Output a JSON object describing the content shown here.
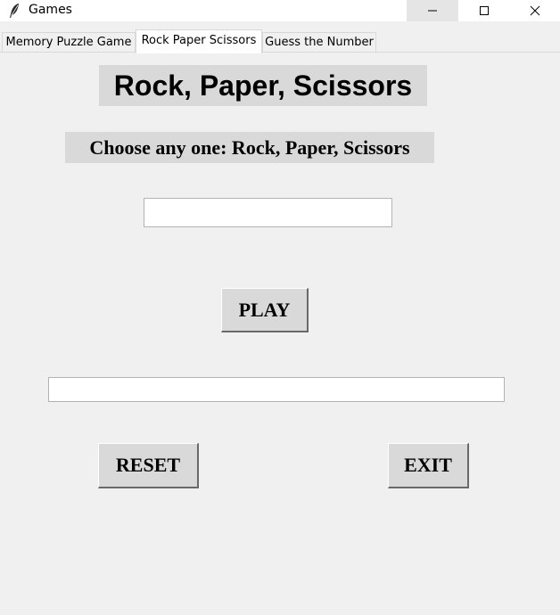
{
  "window": {
    "title": "Games",
    "icon": "feather-icon",
    "controls": [
      "minimize-icon",
      "maximize-icon",
      "close-icon"
    ]
  },
  "tabs": [
    {
      "label": "Memory Puzzle Game",
      "active": false
    },
    {
      "label": "Rock Paper Scissors",
      "active": true
    },
    {
      "label": "Guess the Number",
      "active": false
    }
  ],
  "game": {
    "title": "Rock, Paper, Scissors",
    "instruction": "Choose any one: Rock, Paper, Scissors",
    "choice_value": "",
    "play_label": "PLAY",
    "result_value": "",
    "reset_label": "RESET",
    "exit_label": "EXIT"
  },
  "colors": {
    "background": "#f0f0f0",
    "label_bg": "#d9d9d9",
    "button_bg": "#d9d9d9",
    "field_bg": "#ffffff"
  }
}
